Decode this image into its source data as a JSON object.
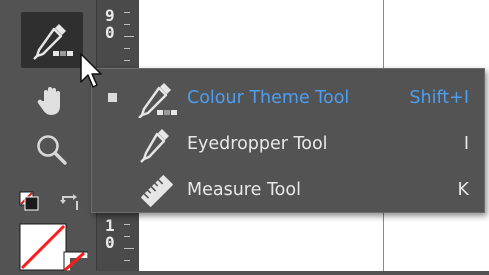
{
  "toolbar": {
    "tools": [
      {
        "icon": "eyedropper-icon",
        "active": true
      },
      {
        "icon": "hand-icon"
      },
      {
        "icon": "zoom-icon"
      },
      {
        "icon": "default-colors-icon"
      },
      {
        "icon": "swap-colors-icon"
      },
      {
        "icon": "fill-stroke-icon"
      }
    ]
  },
  "ruler": {
    "top_digits": [
      "9",
      "0"
    ],
    "bottom_digits": [
      "1",
      "0"
    ]
  },
  "flyout": {
    "items": [
      {
        "label": "Colour Theme Tool",
        "shortcut": "Shift+I",
        "icon": "colour-theme-icon",
        "selected": true
      },
      {
        "label": "Eyedropper Tool",
        "shortcut": "I",
        "icon": "eyedropper-icon",
        "selected": false
      },
      {
        "label": "Measure Tool",
        "shortcut": "K",
        "icon": "ruler-icon",
        "selected": false
      }
    ]
  },
  "colors": {
    "selected_text": "#4d9ef0",
    "menu_bg": "#535353",
    "guide": "#a06ee0",
    "stroke_swatch": "#ff1a1a"
  }
}
